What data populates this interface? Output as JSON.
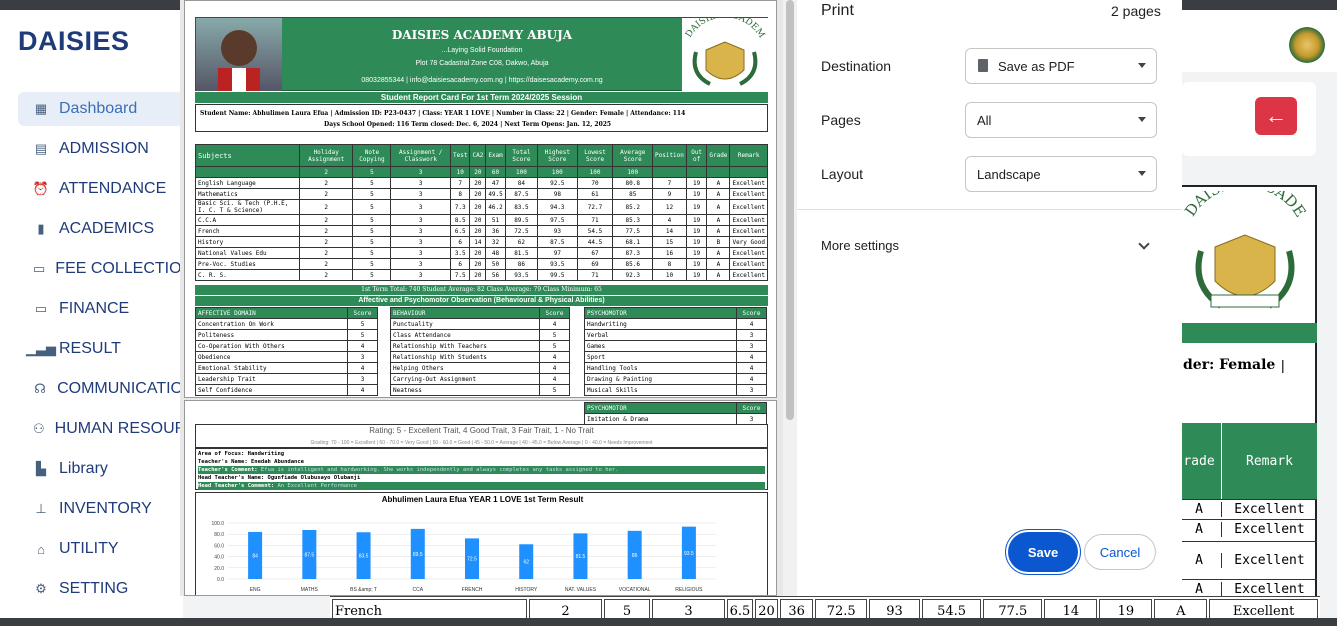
{
  "app": {
    "brand": "DAISIES",
    "nav": [
      {
        "label": "Dashboard",
        "icon": "dashboard-grid-icon"
      },
      {
        "label": "ADMISSION",
        "icon": "admission-book-icon"
      },
      {
        "label": "ATTENDANCE",
        "icon": "alarm-clock-icon"
      },
      {
        "label": "ACADEMICS",
        "icon": "book-icon"
      },
      {
        "label": "FEE COLLECTION",
        "icon": "money-icon"
      },
      {
        "label": "FINANCE",
        "icon": "wallet-icon"
      },
      {
        "label": "RESULT",
        "icon": "bar-chart-icon"
      },
      {
        "label": "COMMUNICATIO",
        "icon": "headset-icon"
      },
      {
        "label": "HUMAN RESOUR",
        "icon": "people-icon"
      },
      {
        "label": "Library",
        "icon": "library-book-icon"
      },
      {
        "label": "INVENTORY",
        "icon": "sitemap-icon"
      },
      {
        "label": "UTILITY",
        "icon": "home-icon"
      },
      {
        "label": "SETTING",
        "icon": "gear-icon"
      }
    ],
    "back_icon": "←",
    "background_card": {
      "gender": "der: Female",
      "grade": "rade",
      "remark": "Remark",
      "rows": [
        "Excellent",
        "Excellent",
        "Excellent",
        "Excellent"
      ]
    },
    "background_row": [
      "French",
      "2",
      "5",
      "3",
      "6.5",
      "20",
      "36",
      "72.5",
      "93",
      "54.5",
      "77.5",
      "14",
      "19",
      "A",
      "Excellent"
    ]
  },
  "report": {
    "school": "DAISIES ACADEMY ABUJA",
    "motto": "...Laying Solid Foundation",
    "address": "Plot 78 Cadastral Zone C08, Dakwo, Abuja",
    "contact": "08032855344 | info@daisiesacademy.com.ng | https://daisesacademy.com.ng",
    "logo_text": "DAISIES ACADEMY",
    "title": "Student Report Card For 1st Term 2024/2025 Session",
    "info1": "Student Name: Abhulimen Laura Efua    | Admission ID: P23-0437    | Class: YEAR 1 LOVE    | Number in Class: 22    | Gender: Female    | Attendance: 114",
    "info2": "Days School Opened: 116        Term closed: Dec. 6, 2024        | Next Term Opens: Jan. 12, 2025",
    "headers": [
      "Subjects",
      "Holiday Assignment",
      "Note Copying",
      "Assignment / Classwork",
      "Test",
      "CA2",
      "Exam",
      "Total Score",
      "Highest Score",
      "Lowest Score",
      "Average Score",
      "Position",
      "Out of",
      "Grade",
      "Remark"
    ],
    "maxrow": [
      "",
      "2",
      "5",
      "3",
      "10",
      "20",
      "60",
      "100",
      "100",
      "100",
      "100",
      "",
      "",
      "",
      ""
    ],
    "subjects": [
      [
        "English Language",
        "2",
        "5",
        "3",
        "7",
        "20",
        "47",
        "84",
        "92.5",
        "70",
        "80.8",
        "7",
        "19",
        "A",
        "Excellent"
      ],
      [
        "Mathematics",
        "2",
        "5",
        "3",
        "8",
        "20",
        "49.5",
        "87.5",
        "98",
        "61",
        "85",
        "9",
        "19",
        "A",
        "Excellent"
      ],
      [
        "Basic Sci. & Tech (P.H.E, I. C. T & Science)",
        "2",
        "5",
        "3",
        "7.3",
        "20",
        "46.2",
        "83.5",
        "94.3",
        "72.7",
        "85.2",
        "12",
        "19",
        "A",
        "Excellent"
      ],
      [
        "C.C.A",
        "2",
        "5",
        "3",
        "8.5",
        "20",
        "51",
        "89.5",
        "97.5",
        "71",
        "85.3",
        "4",
        "19",
        "A",
        "Excellent"
      ],
      [
        "French",
        "2",
        "5",
        "3",
        "6.5",
        "20",
        "36",
        "72.5",
        "93",
        "54.5",
        "77.5",
        "14",
        "19",
        "A",
        "Excellent"
      ],
      [
        "History",
        "2",
        "5",
        "3",
        "6",
        "14",
        "32",
        "62",
        "87.5",
        "44.5",
        "68.1",
        "15",
        "19",
        "B",
        "Very Good"
      ],
      [
        "National Values Edu",
        "2",
        "5",
        "3",
        "3.5",
        "20",
        "48",
        "81.5",
        "97",
        "67",
        "87.3",
        "16",
        "19",
        "A",
        "Excellent"
      ],
      [
        "Pre-Voc. Studies",
        "2",
        "5",
        "3",
        "6",
        "20",
        "50",
        "86",
        "93.5",
        "69",
        "85.6",
        "8",
        "19",
        "A",
        "Excellent"
      ],
      [
        "C. R. S.",
        "2",
        "5",
        "3",
        "7.5",
        "20",
        "56",
        "93.5",
        "99.5",
        "71",
        "92.3",
        "10",
        "19",
        "A",
        "Excellent"
      ]
    ],
    "summary": "1st Term Total: 740     Student Average: 82     Class Average: 79     Class Minimum: 65",
    "observation_title": "Affective and Psychomotor Observation (Behavioural & Physical Abilities)",
    "affective": {
      "title": "AFFECTIVE DOMAIN",
      "score": "Score",
      "rows": [
        [
          "Concentration On Work",
          "5"
        ],
        [
          "Politeness",
          "5"
        ],
        [
          "Co-Operation With Others",
          "4"
        ],
        [
          "Obedience",
          "3"
        ],
        [
          "Emotional Stability",
          "4"
        ],
        [
          "Leadership Trait",
          "3"
        ],
        [
          "Self Confidence",
          "4"
        ]
      ]
    },
    "behaviour": {
      "title": "BEHAVIOUR",
      "score": "Score",
      "rows": [
        [
          "Punctuality",
          "4"
        ],
        [
          "Class Attendance",
          "5"
        ],
        [
          "Relationship With Teachers",
          "5"
        ],
        [
          "Relationship With Students",
          "4"
        ],
        [
          "Helping Others",
          "4"
        ],
        [
          "Carrying-Out Assignment",
          "4"
        ],
        [
          "Neatness",
          "5"
        ]
      ]
    },
    "psychomotor": {
      "title": "PSYCHOMOTOR",
      "score": "Score",
      "rows": [
        [
          "Handwriting",
          "4"
        ],
        [
          "Verbal",
          "3"
        ],
        [
          "Games",
          "3"
        ],
        [
          "Sport",
          "4"
        ],
        [
          "Handling Tools",
          "4"
        ],
        [
          "Drawing & Painting",
          "4"
        ],
        [
          "Musical Skills",
          "3"
        ]
      ]
    },
    "page2_psych": {
      "title": "PSYCHOMOTOR",
      "score": "Score",
      "rows": [
        [
          "Imitation & Drama",
          "3"
        ]
      ]
    },
    "rating": "Rating: 5 - Excellent Trait, 4 Good Trait, 3 Fair Trait, 1 - No Trait",
    "grading": "Grading: 70 - 100 = Excellent | 60 - 70.0 = Very Good | 50 - 60.0 = Good | 45 - 50.0 = Average | 40 - 45.0 = Below Average | 0 - 40.0 = Needs Improvement",
    "focus": "Area of Focus: Handwriting",
    "teacher": "Teacher's Name: Enedah Abundance",
    "teacher_comment_label": "Teacher's Comment:",
    "teacher_comment": "Efua is intelligent and hardworking. She works independently and always completes any tasks assigned to her.",
    "head_teacher": "Head Teacher's Name: Ogunfiade Olubusayo Olubanji",
    "head_comment_label": "Head Teacher's Comment:",
    "head_comment": "An Excellent Performance"
  },
  "chart_data": {
    "type": "bar",
    "title": "Abhulimen Laura Efua YEAR 1 LOVE 1st Term Result",
    "categories": [
      "ENG",
      "MATHS",
      "BS &amp; T",
      "CCA",
      "FRENCH",
      "HISTORY",
      "NAT. VALUES",
      "VOCATIONAL",
      "RELIGIOUS"
    ],
    "values": [
      84,
      87.5,
      83.5,
      89.5,
      72.5,
      62,
      81.5,
      86,
      93.5
    ],
    "yticks": [
      "100.0",
      "80.0",
      "60.0",
      "40.0",
      "20.0",
      "0.0"
    ],
    "ylim": [
      0,
      100
    ],
    "color": "#1e90ff"
  },
  "dialog": {
    "title": "Print",
    "pages_count": "2 pages",
    "destination_label": "Destination",
    "destination_value": "Save as PDF",
    "pages_label": "Pages",
    "pages_value": "All",
    "layout_label": "Layout",
    "layout_value": "Landscape",
    "more_settings": "More settings",
    "save": "Save",
    "cancel": "Cancel"
  }
}
